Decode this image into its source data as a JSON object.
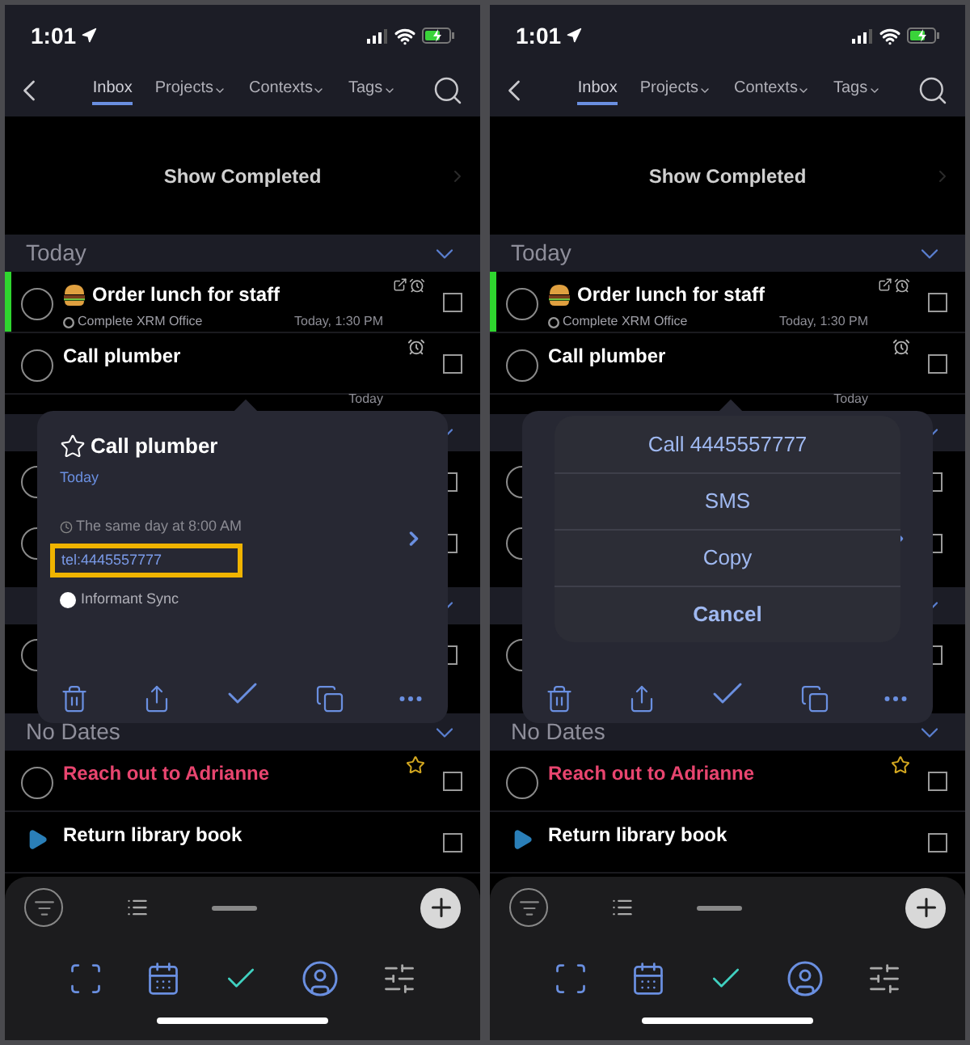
{
  "screens": [
    {
      "status_time": "1:01",
      "tabs": [
        {
          "label": "Inbox",
          "selected": true
        },
        {
          "label": "Projects",
          "selected": false,
          "dropdown": true
        },
        {
          "label": "Contexts",
          "selected": false,
          "dropdown": true
        },
        {
          "label": "Tags",
          "selected": false,
          "dropdown": true
        }
      ],
      "show_completed": "Show Completed",
      "today": {
        "title": "Today",
        "tasks": [
          {
            "kind": "task",
            "title": "Order lunch for staff",
            "emoji": true,
            "project": "Complete XRM Office",
            "due": "Today, 1:30 PM",
            "flagged": true,
            "note": true,
            "alarm": true,
            "checked": false,
            "color": "#ffffff"
          },
          {
            "kind": "task",
            "title": "Call plumber",
            "due": "Today",
            "alarm": true,
            "checked": false,
            "color": "#ffffff"
          }
        ]
      },
      "covered_rows": [
        {
          "checked": false
        },
        {
          "checked": false
        },
        {
          "checked": false
        }
      ],
      "popover": {
        "title": "Call plumber",
        "when": "Today",
        "reminder": "The same day at 8:00 AM",
        "link": {
          "text": "tel:4445557777",
          "highlighted": true
        },
        "calendar": "Informant Sync"
      },
      "no_dates": {
        "title": "No Dates",
        "tasks": [
          {
            "kind": "task",
            "title": "Reach out to Adrianne",
            "starred": true,
            "checked": false,
            "color": "#e8456f"
          },
          {
            "kind": "project",
            "title": "Return library book",
            "checked": false,
            "color": "#ffffff"
          }
        ]
      }
    },
    {
      "status_time": "1:01",
      "tabs": [
        {
          "label": "Inbox",
          "selected": true
        },
        {
          "label": "Projects",
          "selected": false,
          "dropdown": true
        },
        {
          "label": "Contexts",
          "selected": false,
          "dropdown": true
        },
        {
          "label": "Tags",
          "selected": false,
          "dropdown": true
        }
      ],
      "show_completed": "Show Completed",
      "today": {
        "title": "Today",
        "tasks": [
          {
            "kind": "task",
            "title": "Order lunch for staff",
            "emoji": true,
            "project": "Complete XRM Office",
            "due": "Today, 1:30 PM",
            "flagged": true,
            "note": true,
            "alarm": true,
            "checked": false,
            "color": "#ffffff"
          },
          {
            "kind": "task",
            "title": "Call plumber",
            "due": "Today",
            "alarm": true,
            "checked": false,
            "color": "#ffffff"
          }
        ]
      },
      "covered_rows": [
        {
          "checked": false
        },
        {
          "checked": false
        },
        {
          "checked": false
        }
      ],
      "action_sheet": [
        {
          "label": "Call 4445557777",
          "kind": "action"
        },
        {
          "label": "SMS",
          "kind": "action"
        },
        {
          "label": "Copy",
          "kind": "action"
        },
        {
          "label": "Cancel",
          "kind": "cancel"
        }
      ],
      "no_dates": {
        "title": "No Dates",
        "tasks": [
          {
            "kind": "task",
            "title": "Reach out to Adrianne",
            "starred": true,
            "checked": false,
            "color": "#e8456f"
          },
          {
            "kind": "project",
            "title": "Return library book",
            "checked": false,
            "color": "#ffffff"
          }
        ]
      }
    }
  ]
}
